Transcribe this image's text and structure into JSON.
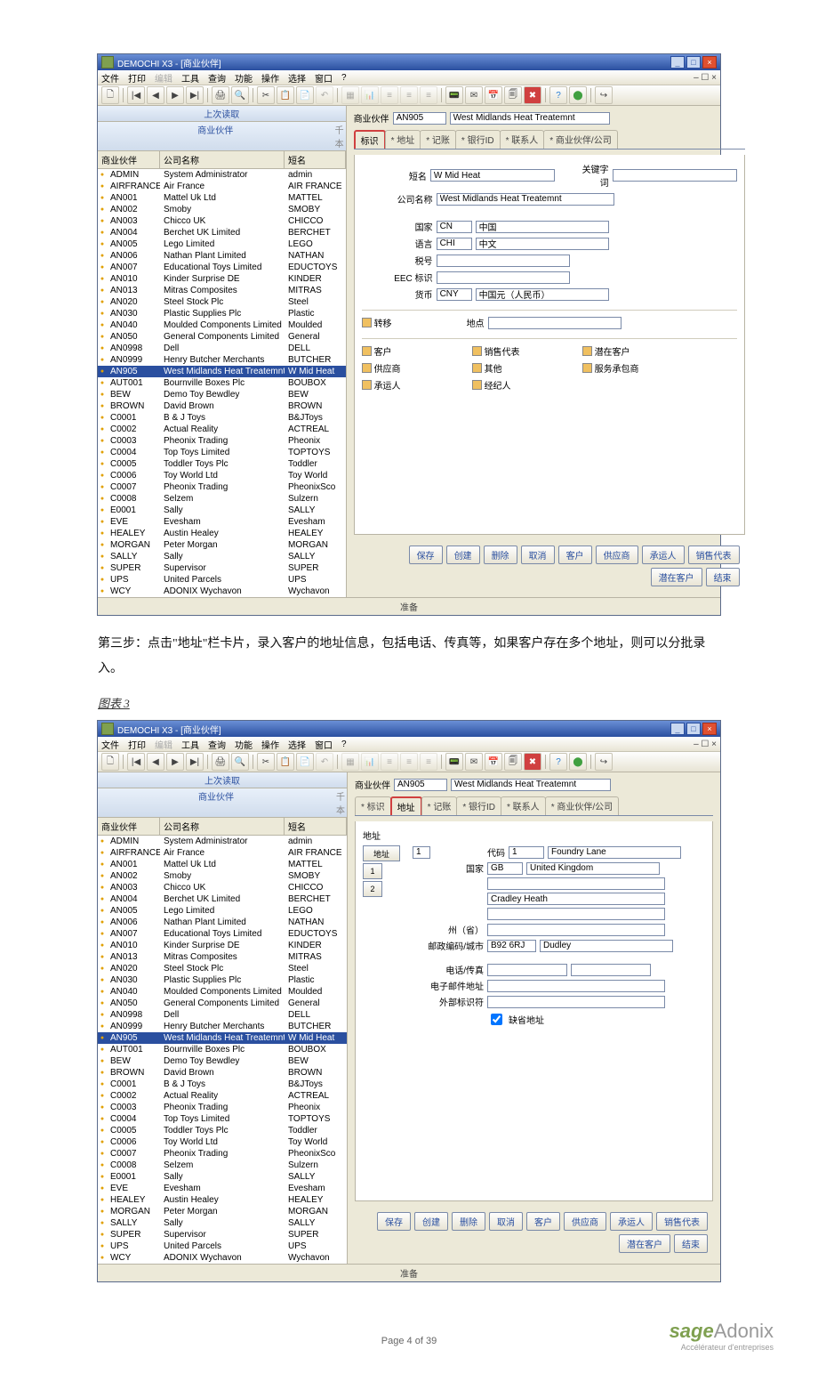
{
  "window_title": "DEMOCHI X3 - [商业伙伴]",
  "menu": [
    "文件",
    "打印",
    "编辑",
    "工具",
    "查询",
    "功能",
    "操作",
    "选择",
    "窗口",
    "?"
  ],
  "pane": {
    "lastread": "上次读取",
    "sub": "商业伙伴",
    "pin": "千本"
  },
  "grid_headers": {
    "code": "商业伙伴",
    "name": "公司名称",
    "short": "短名"
  },
  "rows": [
    {
      "code": "ADMIN",
      "name": "System Administrator",
      "short": "admin"
    },
    {
      "code": "AIRFRANCE",
      "name": "Air France",
      "short": "AIR FRANCE"
    },
    {
      "code": "AN001",
      "name": "Mattel Uk Ltd",
      "short": "MATTEL"
    },
    {
      "code": "AN002",
      "name": "Smoby",
      "short": "SMOBY"
    },
    {
      "code": "AN003",
      "name": "Chicco UK",
      "short": "CHICCO"
    },
    {
      "code": "AN004",
      "name": "Berchet UK Limited",
      "short": "BERCHET"
    },
    {
      "code": "AN005",
      "name": "Lego Limited",
      "short": "LEGO"
    },
    {
      "code": "AN006",
      "name": "Nathan Plant Limited",
      "short": "NATHAN"
    },
    {
      "code": "AN007",
      "name": "Educational Toys Limited",
      "short": "EDUCTOYS"
    },
    {
      "code": "AN010",
      "name": "Kinder Surprise DE",
      "short": "KINDER"
    },
    {
      "code": "AN013",
      "name": "Mitras Composites",
      "short": "MITRAS"
    },
    {
      "code": "AN020",
      "name": "Steel Stock Plc",
      "short": "Steel"
    },
    {
      "code": "AN030",
      "name": "Plastic Supplies Plc",
      "short": "Plastic"
    },
    {
      "code": "AN040",
      "name": "Moulded Components Limited",
      "short": "Moulded"
    },
    {
      "code": "AN050",
      "name": "General Components Limited",
      "short": "General"
    },
    {
      "code": "AN0998",
      "name": "Dell",
      "short": "DELL"
    },
    {
      "code": "AN0999",
      "name": "Henry Butcher Merchants",
      "short": "BUTCHER"
    },
    {
      "code": "AN905",
      "name": "West Midlands Heat Treatemnt",
      "short": "W Mid Heat",
      "selected": true
    },
    {
      "code": "AUT001",
      "name": "Bournville Boxes Plc",
      "short": "BOUBOX"
    },
    {
      "code": "BEW",
      "name": "Demo Toy Bewdley",
      "short": "BEW"
    },
    {
      "code": "BROWN",
      "name": "David Brown",
      "short": "BROWN"
    },
    {
      "code": "C0001",
      "name": "B & J Toys",
      "short": "B&JToys"
    },
    {
      "code": "C0002",
      "name": "Actual Reality",
      "short": "ACTREAL"
    },
    {
      "code": "C0003",
      "name": "Pheonix Trading",
      "short": "Pheonix"
    },
    {
      "code": "C0004",
      "name": "Top Toys Limited",
      "short": "TOPTOYS"
    },
    {
      "code": "C0005",
      "name": "Toddler Toys Plc",
      "short": "Toddler"
    },
    {
      "code": "C0006",
      "name": "Toy World Ltd",
      "short": "Toy World"
    },
    {
      "code": "C0007",
      "name": "Pheonix Trading",
      "short": "PheonixSco"
    },
    {
      "code": "C0008",
      "name": "Selzem",
      "short": "Sulzern"
    },
    {
      "code": "E0001",
      "name": "Sally",
      "short": "SALLY"
    },
    {
      "code": "EVE",
      "name": "Evesham",
      "short": "Evesham"
    },
    {
      "code": "HEALEY",
      "name": "Austin Healey",
      "short": "HEALEY"
    },
    {
      "code": "MORGAN",
      "name": "Peter Morgan",
      "short": "MORGAN"
    },
    {
      "code": "SALLY",
      "name": "Sally",
      "short": "SALLY"
    },
    {
      "code": "SUPER",
      "name": "Supervisor",
      "short": "SUPER"
    },
    {
      "code": "UPS",
      "name": "United Parcels",
      "short": "UPS"
    },
    {
      "code": "WCY",
      "name": "ADONIX Wychavon",
      "short": "Wychavon"
    }
  ],
  "form1": {
    "top_label": "商业伙伴",
    "code": "AN905",
    "desc": "West Midlands Heat Treatemnt",
    "tabs": [
      "标识",
      "* 地址",
      "* 记账",
      "* 银行ID",
      "* 联系人",
      "* 商业伙伴/公司"
    ],
    "active_tab": 0,
    "shortname_lbl": "短名",
    "shortname": "W Mid Heat",
    "keyword_lbl": "关键字词",
    "keyword": "",
    "company_lbl": "公司名称",
    "company": "West Midlands Heat Treatemnt",
    "country_lbl": "国家",
    "country_code": "CN",
    "country": "中国",
    "lang_lbl": "语言",
    "lang_code": "CHI",
    "lang": "中文",
    "tax_lbl": "税号",
    "eec_lbl": "EEC 标识",
    "currency_lbl": "货币",
    "currency_code": "CNY",
    "currency": "中国元（人民币）",
    "transfer_lbl": "转移",
    "addrpt_lbl": "地点",
    "checks": [
      {
        "k": "c1",
        "label": "客户"
      },
      {
        "k": "c2",
        "label": "销售代表"
      },
      {
        "k": "c3",
        "label": "潜在客户"
      },
      {
        "k": "c4",
        "label": "供应商"
      },
      {
        "k": "c5",
        "label": "其他"
      },
      {
        "k": "c6",
        "label": "服务承包商"
      },
      {
        "k": "c7",
        "label": "承运人"
      },
      {
        "k": "c8",
        "label": "经纪人"
      }
    ]
  },
  "form2": {
    "tabs": [
      "* 标识",
      "地址",
      "* 记账",
      "* 银行ID",
      "* 联系人",
      "* 商业伙伴/公司"
    ],
    "active_tab": 1,
    "addr_lbl": "地址",
    "addr_sub": "地址",
    "code_lbl": "代码",
    "code": "1",
    "code_desc": "Foundry Lane",
    "row1": "1",
    "row2": "2",
    "val1": "1",
    "country_lbl": "国家",
    "country_code": "GB",
    "country": "United Kingdom",
    "city": "Cradley Heath",
    "state_lbl": "州（省）",
    "zip_lbl": "邮政编码/城市",
    "zip": "B92 6RJ",
    "zipcity": "Dudley",
    "phone_lbl": "电话/传真",
    "email_lbl": "电子邮件地址",
    "ext_lbl": "外部标识符",
    "default_lbl": "缺省地址",
    "default_chk": true
  },
  "footer_btns": [
    "保存",
    "创建",
    "删除",
    "取消",
    "客户",
    "供应商",
    "承运人",
    "销售代表",
    "潜在客户",
    "结束"
  ],
  "statusbar": "准备",
  "instruction": "第三步：点击\"地址\"栏卡片，录入客户的地址信息，包括电话、传真等，如果客户存在多个地址，则可以分批录入。",
  "fig_label": "图表 3",
  "page_footer": "Page 4 of 39",
  "logo": {
    "sage": "sage",
    "adonix": "Adonix",
    "tag": "Accélérateur d'entreprises"
  }
}
